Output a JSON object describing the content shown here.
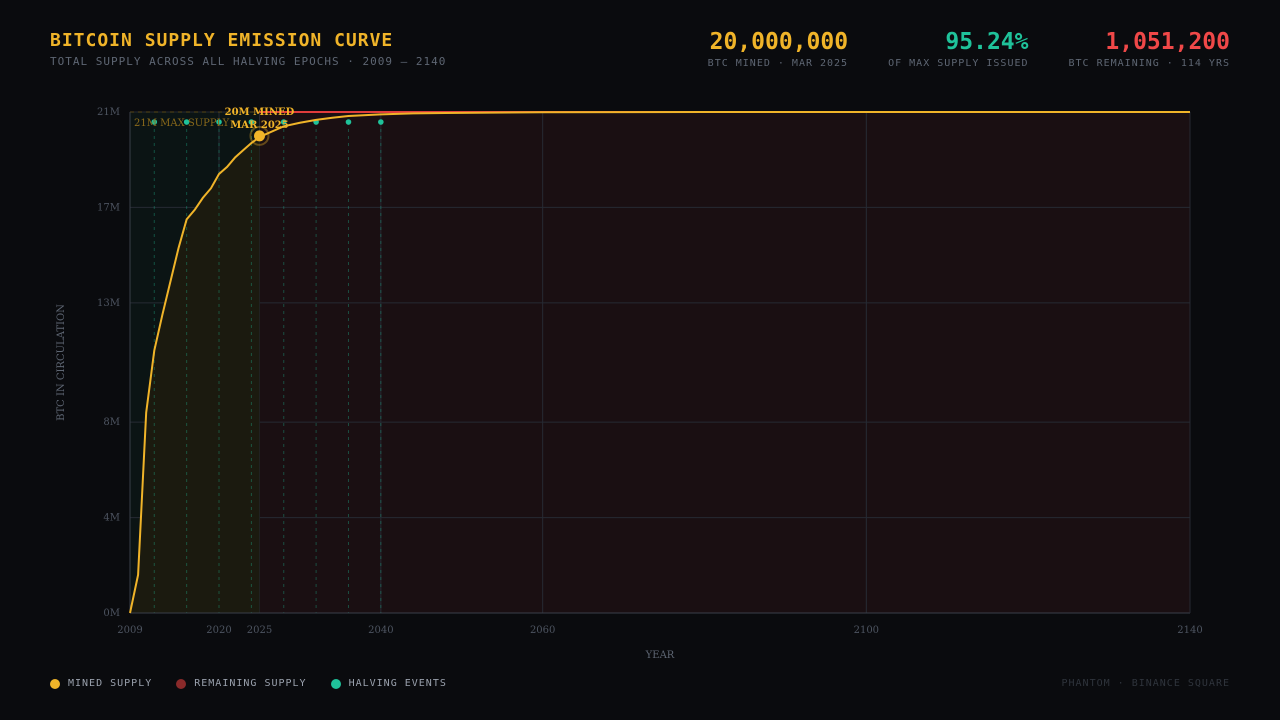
{
  "header": {
    "title": "BITCOIN SUPPLY EMISSION CURVE",
    "subtitle": "TOTAL SUPPLY ACROSS ALL HALVING EPOCHS · 2009 — 2140"
  },
  "stats": [
    {
      "value": "20,000,000",
      "label": "BTC MINED · MAR 2025",
      "color": "#f0b429"
    },
    {
      "value": "95.24%",
      "label": "OF MAX SUPPLY ISSUED",
      "color": "#1fc29a"
    },
    {
      "value": "1,051,200",
      "label": "BTC REMAINING · 114 YRS",
      "color": "#f04848"
    }
  ],
  "legend": [
    {
      "label": "MINED SUPPLY",
      "color": "#f0b429"
    },
    {
      "label": "REMAINING SUPPLY",
      "color": "#8a2a2a"
    },
    {
      "label": "HALVING EVENTS",
      "color": "#1fc29a"
    }
  ],
  "credit": "PHANTOM · BINANCE SQUARE",
  "colors": {
    "mined": "#f0b429",
    "remaining_fill": "#1a0f12",
    "mined_fill": "#1b1a0f",
    "max_line": "#e03c3c",
    "halving": "#1fc29a",
    "grid": "#262a33"
  },
  "chart_data": {
    "type": "area",
    "xlabel": "YEAR",
    "ylabel": "BTC IN CIRCULATION",
    "xlim": [
      2009,
      2140
    ],
    "ylim": [
      0,
      21
    ],
    "x_ticks": [
      2009,
      2020,
      2025,
      2040,
      2060,
      2100,
      2140
    ],
    "x_tick_labels": [
      "2009",
      "2020",
      "2025",
      "2040",
      "2060",
      "2100",
      "2140"
    ],
    "y_ticks": [
      0,
      4,
      8,
      13,
      17,
      21
    ],
    "y_tick_labels": [
      "0M",
      "4M",
      "8M",
      "13M",
      "17M",
      "21M"
    ],
    "grid": true,
    "series": [
      {
        "name": "MINED SUPPLY",
        "x": [
          2009,
          2010,
          2011,
          2012,
          2013,
          2014,
          2015,
          2016,
          2017,
          2018,
          2019,
          2020,
          2021,
          2022,
          2023,
          2024,
          2025,
          2026,
          2027,
          2028,
          2030,
          2032,
          2034,
          2036,
          2040,
          2044,
          2048,
          2060,
          2080,
          2100,
          2140
        ],
        "y": [
          0,
          1.6,
          8.4,
          11.0,
          12.5,
          13.9,
          15.3,
          16.5,
          16.9,
          17.4,
          17.8,
          18.4,
          18.7,
          19.1,
          19.4,
          19.7,
          19.95,
          20.1,
          20.25,
          20.4,
          20.55,
          20.67,
          20.76,
          20.83,
          20.9,
          20.94,
          20.96,
          20.99,
          21.0,
          21.0,
          21.0
        ]
      }
    ],
    "max_supply": 21,
    "max_supply_label": "21M MAX SUPPLY",
    "halving_years": [
      2012,
      2016,
      2020,
      2024,
      2028,
      2032,
      2036,
      2040
    ],
    "highlight": {
      "x": 2025,
      "y": 20.0,
      "label_line1": "20M MINED",
      "label_line2": "MAR 2025"
    },
    "remaining_region": "right of 2025"
  }
}
